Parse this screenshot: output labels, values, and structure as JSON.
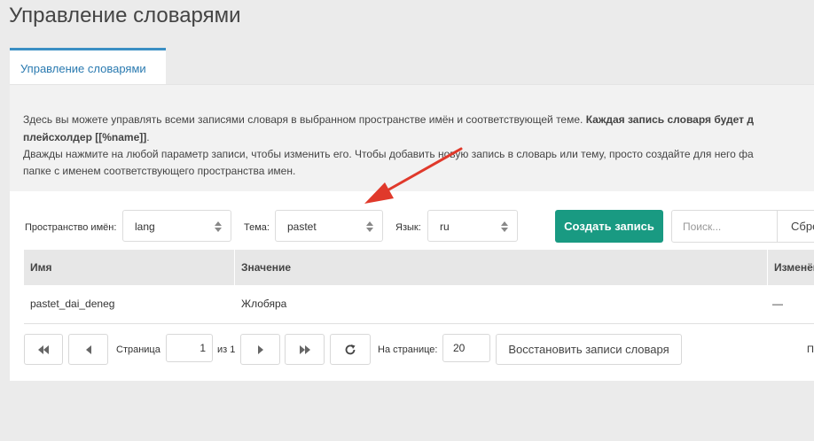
{
  "page": {
    "title": "Управление словарями"
  },
  "tab": {
    "label": "Управление словарями"
  },
  "info": {
    "line1_normal": "Здесь вы можете управлять всеми записями словаря в выбранном пространстве имён и соответствующей теме. ",
    "line1_bold": "Каждая запись словаря будет д",
    "line2_bold": "плейсхолдер [[%name]]",
    "line2_normal": ".",
    "line3": "Дважды нажмите на любой параметр записи, чтобы изменить его. Чтобы добавить новую запись в словарь или тему, просто создайте для него фа",
    "line4": "папке с именем соответствующего пространства имен."
  },
  "filters": {
    "namespace_label": "Пространство имён:",
    "namespace_value": "lang",
    "topic_label": "Тема:",
    "topic_value": "pastet",
    "language_label": "Язык:",
    "language_value": "ru"
  },
  "toolbar": {
    "create_label": "Создать запись",
    "search_placeholder": "Поиск...",
    "reset_label": "Сбро"
  },
  "table": {
    "columns": [
      "Имя",
      "Значение",
      "Изменён"
    ],
    "rows": [
      {
        "name": "pastet_dai_deneg",
        "value": "Жлобяра",
        "changed": "—"
      }
    ]
  },
  "pagination": {
    "page_label": "Страница",
    "page_value": "1",
    "of_label": "из 1",
    "per_page_label": "На странице:",
    "per_page_value": "20",
    "restore_label": "Восстановить записи словаря",
    "trailing_text": "П"
  },
  "icons": {
    "first": "double-chevron-left-icon",
    "prev": "chevron-left-icon",
    "next": "chevron-right-icon",
    "last": "double-chevron-right-icon",
    "refresh": "refresh-icon",
    "select_arrows": "up-down-arrows-icon"
  },
  "colors": {
    "accent": "#199a82",
    "tab_border": "#3a8fc4",
    "annotation_arrow": "#e0392b"
  }
}
